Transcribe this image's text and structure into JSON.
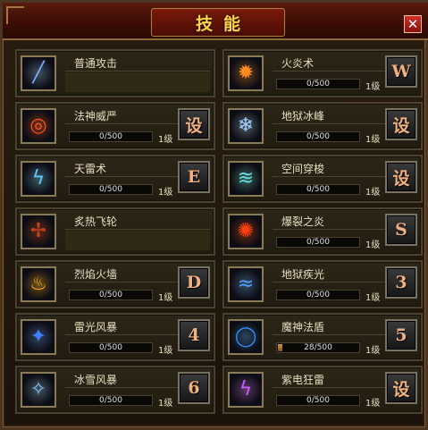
{
  "window": {
    "title": "技能",
    "close_label": "✕"
  },
  "skills": [
    {
      "name": "普通攻击",
      "progress": "",
      "level": "",
      "key": "",
      "icon": "sword-icon",
      "icon_glyph": "╱",
      "icon_color": "#7ab0ff",
      "fill": 0,
      "has_bar": false
    },
    {
      "name": "火炎术",
      "progress": "0/500",
      "level": "1级",
      "key": "W",
      "icon": "fireball-icon",
      "icon_glyph": "✹",
      "icon_color": "#ff8a20",
      "fill": 0,
      "has_bar": true
    },
    {
      "name": "法神威严",
      "progress": "0/500",
      "level": "1级",
      "key": "设",
      "icon": "fire-ring-icon",
      "icon_glyph": "◎",
      "icon_color": "#ff5020",
      "fill": 0,
      "has_bar": true
    },
    {
      "name": "地狱冰峰",
      "progress": "0/500",
      "level": "1级",
      "key": "设",
      "icon": "ice-peak-icon",
      "icon_glyph": "❄",
      "icon_color": "#a0d0ff",
      "fill": 0,
      "has_bar": true
    },
    {
      "name": "天雷术",
      "progress": "0/500",
      "level": "1级",
      "key": "E",
      "icon": "lightning-icon",
      "icon_glyph": "ϟ",
      "icon_color": "#60c8ff",
      "fill": 0,
      "has_bar": true
    },
    {
      "name": "空间穿梭",
      "progress": "0/500",
      "level": "1级",
      "key": "设",
      "icon": "teleport-icon",
      "icon_glyph": "≋",
      "icon_color": "#60e0e0",
      "fill": 0,
      "has_bar": true
    },
    {
      "name": "炙热飞轮",
      "progress": "",
      "level": "",
      "key": "",
      "icon": "flame-wheel-icon",
      "icon_glyph": "✢",
      "icon_color": "#c04020",
      "fill": 0,
      "has_bar": false
    },
    {
      "name": "爆裂之炎",
      "progress": "0/500",
      "level": "1级",
      "key": "S",
      "icon": "explosion-icon",
      "icon_glyph": "✺",
      "icon_color": "#ff4010",
      "fill": 0,
      "has_bar": true
    },
    {
      "name": "烈焰火墙",
      "progress": "0/500",
      "level": "1级",
      "key": "D",
      "icon": "fire-wall-icon",
      "icon_glyph": "♨",
      "icon_color": "#ffb020",
      "fill": 0,
      "has_bar": true
    },
    {
      "name": "地狱疾光",
      "progress": "0/500",
      "level": "1级",
      "key": "3",
      "icon": "hell-light-icon",
      "icon_glyph": "≈",
      "icon_color": "#50a0ff",
      "fill": 0,
      "has_bar": true
    },
    {
      "name": "雷光风暴",
      "progress": "0/500",
      "level": "1级",
      "key": "4",
      "icon": "thunder-storm-icon",
      "icon_glyph": "✦",
      "icon_color": "#4080ff",
      "fill": 0,
      "has_bar": true
    },
    {
      "name": "魔神法盾",
      "progress": "28/500",
      "level": "1级",
      "key": "5",
      "icon": "magic-shield-icon",
      "icon_glyph": "◯",
      "icon_color": "#3090ff",
      "fill": 0.056,
      "has_bar": true
    },
    {
      "name": "冰雪风暴",
      "progress": "0/500",
      "level": "1级",
      "key": "6",
      "icon": "blizzard-icon",
      "icon_glyph": "✧",
      "icon_color": "#80c0ff",
      "fill": 0,
      "has_bar": true
    },
    {
      "name": "紫电狂雷",
      "progress": "0/500",
      "level": "1级",
      "key": "设",
      "icon": "purple-thunder-icon",
      "icon_glyph": "ϟ",
      "icon_color": "#c060ff",
      "fill": 0,
      "has_bar": true
    }
  ]
}
